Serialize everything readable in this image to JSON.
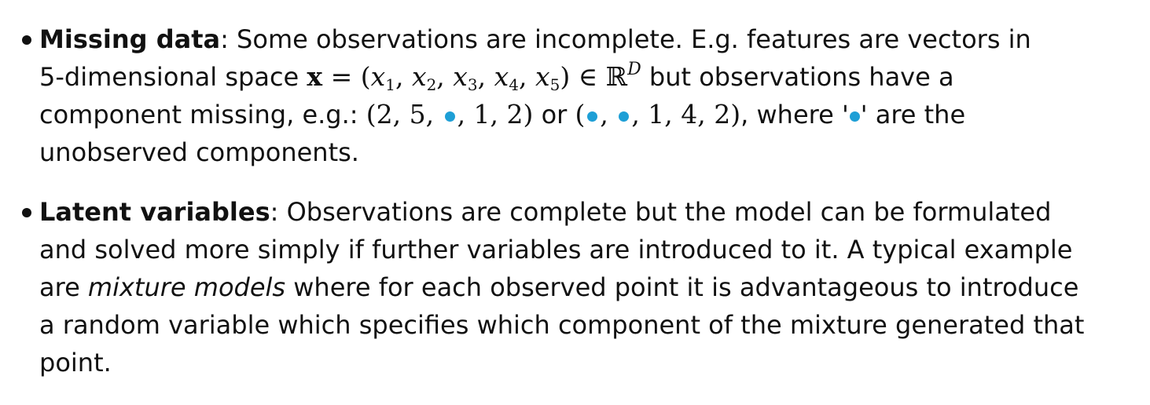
{
  "colors": {
    "text": "#111111",
    "missing_marker": "#1e9fd6"
  },
  "missing": {
    "term": "Missing data",
    "intro": ": Some observations are incomplete.  E.g.  features are vectors in",
    "l2_a": "5-dimensional space ",
    "vec_var": "x",
    "eq": " = (",
    "x": "x",
    "sub1": "1",
    "sub2": "2",
    "sub3": "3",
    "sub4": "4",
    "sub5": "5",
    "comma": ", ",
    "close_in": ") ∈ ",
    "reals": "ℝ",
    "dim": "D",
    "l2_b": " but observations have a",
    "l3_a": "component missing, e.g.:  ",
    "ex1_a": "(2, 5, ",
    "ex1_b": ", 1, 2)",
    "or": " or ",
    "ex2_a": "(",
    "ex2_sep": ", ",
    "ex2_b": ", 1, 4, 2)",
    "l3_b": ", where '",
    "l3_c": "' are the",
    "l4": "unobserved components."
  },
  "latent": {
    "term": "Latent variables",
    "intro": ": Observations are complete but the model can be formulated",
    "l2": "and solved more simply if further variables are introduced to it.  A typical example",
    "l3_a": "are ",
    "l3_emph": "mixture models",
    "l3_b": " where for each observed point it is advantageous to introduce",
    "l4": "a random variable which specifies which component of the mixture generated that",
    "l5": "point."
  }
}
